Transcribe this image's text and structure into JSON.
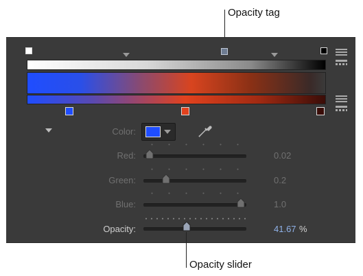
{
  "callouts": {
    "top": "Opacity tag",
    "bottom": "Opacity slider"
  },
  "color_row": {
    "label": "Color:",
    "swatch_color": "#1f4dff"
  },
  "params": [
    {
      "label": "Red:",
      "value": "0.02",
      "active": false,
      "fraction": 0.02
    },
    {
      "label": "Green:",
      "value": "0.2",
      "active": false,
      "fraction": 0.2
    },
    {
      "label": "Blue:",
      "value": "1.0",
      "active": false,
      "fraction": 1.0
    },
    {
      "label": "Opacity:",
      "value": "41.67",
      "unit": "%",
      "active": true,
      "fraction": 0.4167
    }
  ],
  "colors": {
    "panel_bg": "#3a3a3a",
    "active_value": "#8fb1e8",
    "gradient_blue": "#1f4dff",
    "gradient_orange": "#e2421e",
    "gradient_dark": "#3a0d08"
  }
}
